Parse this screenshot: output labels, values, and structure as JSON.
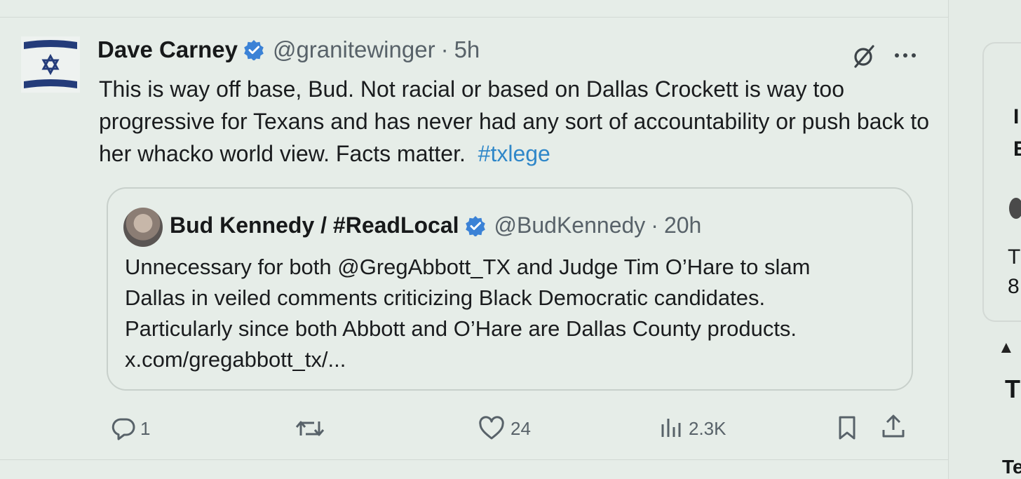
{
  "tweet": {
    "author_name": "Dave Carney",
    "handle": "@granitewinger",
    "separator": "·",
    "time": "5h",
    "text": "This is way off base, Bud. Not racial or based on Dallas Crockett is way too progressive for Texans and has never had any sort of accountability or push back to her whacko world view. Facts matter.",
    "hashtag": "#txlege",
    "icons": {
      "verified": "verified-badge-icon",
      "grok": "grok-icon",
      "more": "more-dots-icon",
      "avatar": "israel-flag-avatar"
    }
  },
  "quote": {
    "author_name": "Bud Kennedy / #ReadLocal",
    "handle": "@BudKennedy",
    "separator": "·",
    "time": "20h",
    "text_lines": [
      "Unnecessary for both @GregAbbott_TX and Judge Tim O’Hare to slam",
      "Dallas in veiled comments criticizing Black Democratic candidates.",
      "Particularly since both Abbott and O’Hare are Dallas County products.",
      "x.com/gregabbott_tx/..."
    ]
  },
  "actions": {
    "replies": "1",
    "retweets": "",
    "likes": "24",
    "views": "2.3K",
    "icons": [
      "reply-icon",
      "retweet-icon",
      "like-icon",
      "views-icon",
      "bookmark-icon",
      "share-icon"
    ]
  },
  "right_panel": {
    "fragments": [
      "I",
      "E",
      "T",
      "8",
      "T",
      "Te"
    ]
  },
  "colors": {
    "accent": "#2f87c9",
    "verified": "#3b82d6",
    "muted": "#586269",
    "background": "#e6ede8"
  }
}
